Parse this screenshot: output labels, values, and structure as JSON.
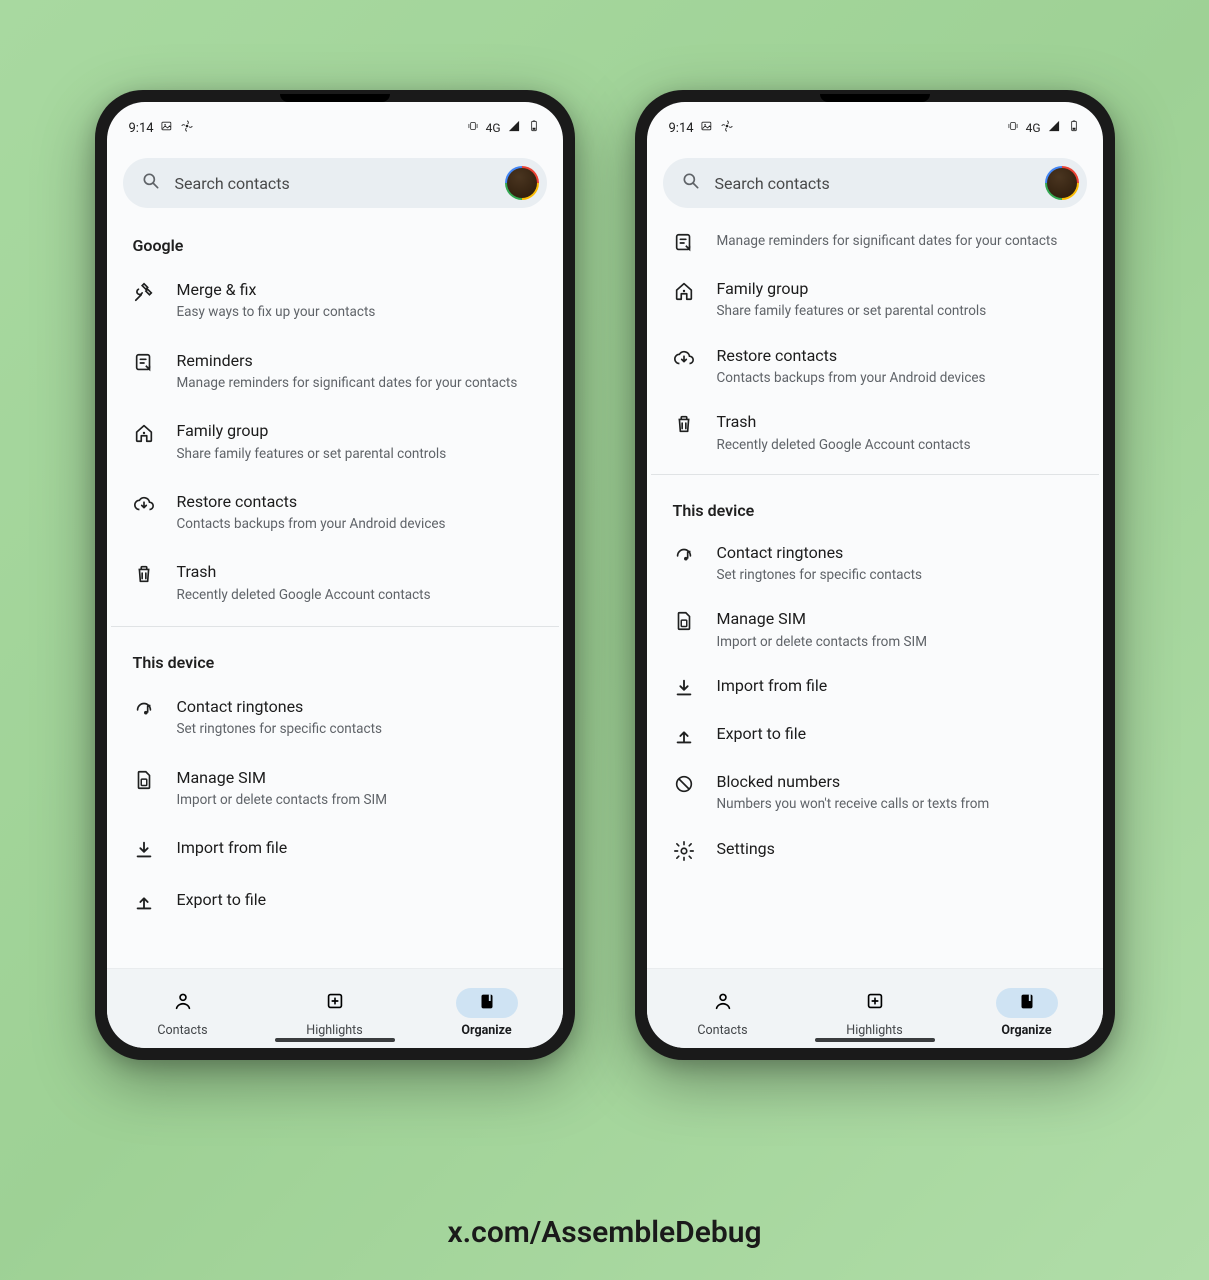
{
  "status": {
    "time": "9:14",
    "network": "4G"
  },
  "search": {
    "placeholder": "Search contacts"
  },
  "phone1": {
    "sections": [
      {
        "title": "Google",
        "items": [
          {
            "icon": "tools",
            "title": "Merge & fix",
            "sub": "Easy ways to fix up your contacts"
          },
          {
            "icon": "note",
            "title": "Reminders",
            "sub": "Manage reminders for significant dates for your contacts"
          },
          {
            "icon": "home",
            "title": "Family group",
            "sub": "Share family features or set parental controls"
          },
          {
            "icon": "cloud-download",
            "title": "Restore contacts",
            "sub": "Contacts backups from your Android devices"
          },
          {
            "icon": "trash",
            "title": "Trash",
            "sub": "Recently deleted Google Account contacts"
          }
        ]
      },
      {
        "title": "This device",
        "items": [
          {
            "icon": "music-note",
            "title": "Contact ringtones",
            "sub": "Set ringtones for specific contacts"
          },
          {
            "icon": "sim",
            "title": "Manage SIM",
            "sub": "Import or delete contacts from SIM"
          },
          {
            "icon": "download",
            "title": "Import from file",
            "sub": ""
          },
          {
            "icon": "upload",
            "title": "Export to file",
            "sub": ""
          }
        ]
      }
    ]
  },
  "phone2": {
    "topPartial": {
      "icon": "note",
      "sub": "Manage reminders for significant dates for your contacts"
    },
    "googleRest": [
      {
        "icon": "home",
        "title": "Family group",
        "sub": "Share family features or set parental controls"
      },
      {
        "icon": "cloud-download",
        "title": "Restore contacts",
        "sub": "Contacts backups from your Android devices"
      },
      {
        "icon": "trash",
        "title": "Trash",
        "sub": "Recently deleted Google Account contacts"
      }
    ],
    "device": {
      "title": "This device",
      "items": [
        {
          "icon": "music-note",
          "title": "Contact ringtones",
          "sub": "Set ringtones for specific contacts"
        },
        {
          "icon": "sim",
          "title": "Manage SIM",
          "sub": "Import or delete contacts from SIM"
        },
        {
          "icon": "download",
          "title": "Import from file",
          "sub": ""
        },
        {
          "icon": "upload",
          "title": "Export to file",
          "sub": ""
        },
        {
          "icon": "block",
          "title": "Blocked numbers",
          "sub": "Numbers you won't receive calls or texts from"
        },
        {
          "icon": "settings",
          "title": "Settings",
          "sub": ""
        }
      ]
    }
  },
  "nav": {
    "items": [
      {
        "id": "contacts",
        "label": "Contacts"
      },
      {
        "id": "highlights",
        "label": "Highlights"
      },
      {
        "id": "organize",
        "label": "Organize"
      }
    ],
    "active": "organize"
  },
  "caption": "x.com/AssembleDebug"
}
